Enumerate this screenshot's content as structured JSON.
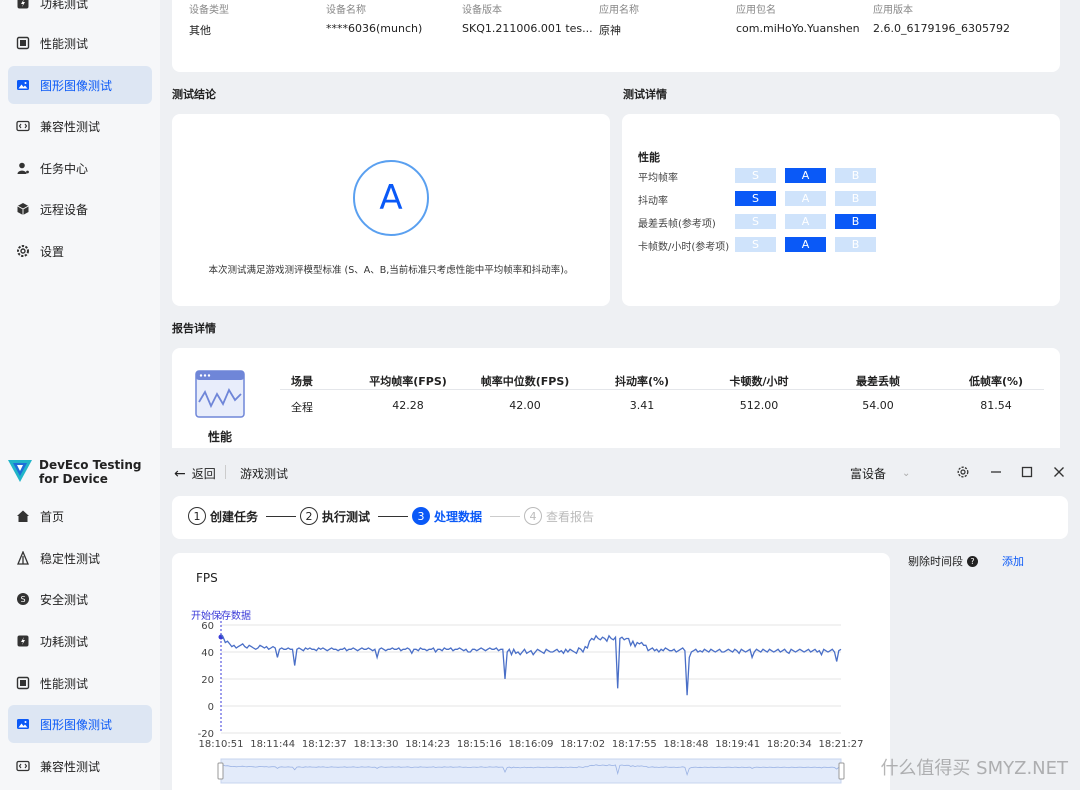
{
  "sidebar_top": {
    "items": [
      {
        "label": "功耗测试",
        "icon": "power-icon"
      },
      {
        "label": "性能测试",
        "icon": "performance-icon"
      },
      {
        "label": "图形图像测试",
        "icon": "image-icon",
        "active": true
      },
      {
        "label": "兼容性测试",
        "icon": "code-icon"
      },
      {
        "label": "任务中心",
        "icon": "user-icon"
      },
      {
        "label": "远程设备",
        "icon": "cube-icon"
      },
      {
        "label": "设置",
        "icon": "gear-icon"
      }
    ]
  },
  "device_info": {
    "labels": [
      "设备类型",
      "设备名称",
      "设备版本",
      "应用名称",
      "应用包名",
      "应用版本"
    ],
    "values": [
      "其他",
      "****6036(munch)",
      "SKQ1.211006.001 tes...",
      "原神",
      "com.miHoYo.Yuanshen",
      "2.6.0_6179196_6305792"
    ]
  },
  "conclusion": {
    "title": "测试结论",
    "grade": "A",
    "description": "本次测试满足游戏测评模型标准 (S、A、B,当前标准只考虑性能中平均帧率和抖动率)。"
  },
  "details": {
    "title": "测试详情",
    "section": "性能",
    "grade_options": [
      "S",
      "A",
      "B"
    ],
    "rows": [
      {
        "label": "平均帧率",
        "grade": "A"
      },
      {
        "label": "抖动率",
        "grade": "S"
      },
      {
        "label": "最差丢帧(参考项)",
        "grade": "B"
      },
      {
        "label": "卡帧数/小时(参考项)",
        "grade": "A"
      }
    ]
  },
  "report": {
    "title": "报告详情",
    "card_label": "性能",
    "headers": [
      "场景",
      "平均帧率(FPS)",
      "帧率中位数(FPS)",
      "抖动率(%)",
      "卡顿数/小时",
      "最差丢帧",
      "低帧率(%)"
    ],
    "row": [
      "全程",
      "42.28",
      "42.00",
      "3.41",
      "512.00",
      "54.00",
      "81.54"
    ]
  },
  "app": {
    "brand_line1": "DevEco Testing",
    "brand_line2": "for Device",
    "back_label": "返回",
    "page_title": "游戏测试",
    "device_select": "富设备"
  },
  "sidebar_bottom": {
    "items": [
      {
        "label": "首页",
        "icon": "home-icon"
      },
      {
        "label": "稳定性测试",
        "icon": "stability-icon"
      },
      {
        "label": "安全测试",
        "icon": "security-icon"
      },
      {
        "label": "功耗测试",
        "icon": "power-icon"
      },
      {
        "label": "性能测试",
        "icon": "performance-icon"
      },
      {
        "label": "图形图像测试",
        "icon": "image-icon",
        "active": true
      },
      {
        "label": "兼容性测试",
        "icon": "code-icon"
      }
    ]
  },
  "steps": [
    {
      "num": "1",
      "label": "创建任务",
      "state": "done"
    },
    {
      "num": "2",
      "label": "执行测试",
      "state": "done"
    },
    {
      "num": "3",
      "label": "处理数据",
      "state": "current"
    },
    {
      "num": "4",
      "label": "查看报告",
      "state": "pending"
    }
  ],
  "side_panel": {
    "label": "剔除时间段",
    "help_icon": "help-icon",
    "add_label": "添加"
  },
  "watermark": "什么值得买 SMYZ.NET",
  "colors": {
    "accent": "#0a59f7",
    "line": "#4a6fc7",
    "marker": "#3a3ad8"
  },
  "chart_data": {
    "type": "line",
    "title": "FPS",
    "annotation": "开始保存数据",
    "ylim": [
      -20,
      60
    ],
    "yticks": [
      60,
      40,
      20,
      0,
      -20
    ],
    "xticks": [
      "18:10:51",
      "18:11:44",
      "18:12:37",
      "18:13:30",
      "18:14:23",
      "18:15:16",
      "18:16:09",
      "18:17:02",
      "18:17:55",
      "18:18:48",
      "18:19:41",
      "18:20:34",
      "18:21:27"
    ],
    "series": [
      {
        "values": [
          53,
          51,
          47,
          48,
          46,
          44,
          45,
          43,
          44,
          45,
          46,
          44,
          43,
          45,
          44,
          43,
          42,
          43,
          45,
          44,
          43,
          44,
          42,
          43,
          44,
          43,
          36,
          42,
          43,
          42,
          42,
          43,
          42,
          42,
          30,
          42,
          43,
          42,
          41,
          43,
          42,
          43,
          42,
          42,
          41,
          43,
          42,
          43,
          42,
          41,
          42,
          43,
          42,
          42,
          41,
          42,
          42,
          43,
          41,
          42,
          42,
          43,
          42,
          41,
          42,
          43,
          42,
          42,
          43,
          42,
          41,
          42,
          36,
          42,
          43,
          42,
          41,
          42,
          42,
          43,
          42,
          42,
          43,
          41,
          42,
          42,
          43,
          42,
          39,
          42,
          42,
          41,
          43,
          42,
          42,
          41,
          42,
          42,
          43,
          40,
          42,
          42,
          41,
          43,
          42,
          42,
          43,
          41,
          42,
          42,
          43,
          42,
          41,
          42,
          40,
          40,
          42,
          42,
          41,
          42,
          43,
          42,
          41,
          42,
          43,
          42,
          42,
          43,
          41,
          42,
          42,
          20,
          40,
          42,
          38,
          42,
          39,
          40,
          38,
          40,
          42,
          39,
          40,
          41,
          38,
          40,
          42,
          41,
          40,
          39,
          42,
          41,
          40,
          40,
          41,
          42,
          40,
          41,
          39,
          42,
          40,
          42,
          41,
          40,
          39,
          43,
          42,
          40,
          44,
          43,
          48,
          50,
          49,
          52,
          50,
          49,
          51,
          50,
          48,
          52,
          50,
          49,
          51,
          13,
          50,
          51,
          49,
          50,
          50,
          45,
          48,
          44,
          47,
          46,
          47,
          45,
          45,
          41,
          42,
          43,
          41,
          42,
          40,
          42,
          41,
          43,
          42,
          41,
          41,
          42,
          40,
          41,
          42,
          43,
          41,
          8,
          36,
          40,
          41,
          42,
          40,
          41,
          40,
          42,
          41,
          40,
          42,
          41,
          40,
          41,
          42,
          40,
          40,
          41,
          42,
          41,
          40,
          42,
          41,
          39,
          42,
          41,
          40,
          41,
          42,
          36,
          40,
          42,
          41,
          40,
          42,
          41,
          40,
          42,
          41,
          40,
          41,
          42,
          40,
          41,
          42,
          40,
          39,
          42,
          41,
          40,
          41,
          42,
          41,
          40,
          41,
          42,
          40,
          41,
          42,
          40,
          41,
          38,
          42,
          41,
          40,
          41,
          42,
          40,
          33,
          41,
          42
        ]
      }
    ]
  }
}
